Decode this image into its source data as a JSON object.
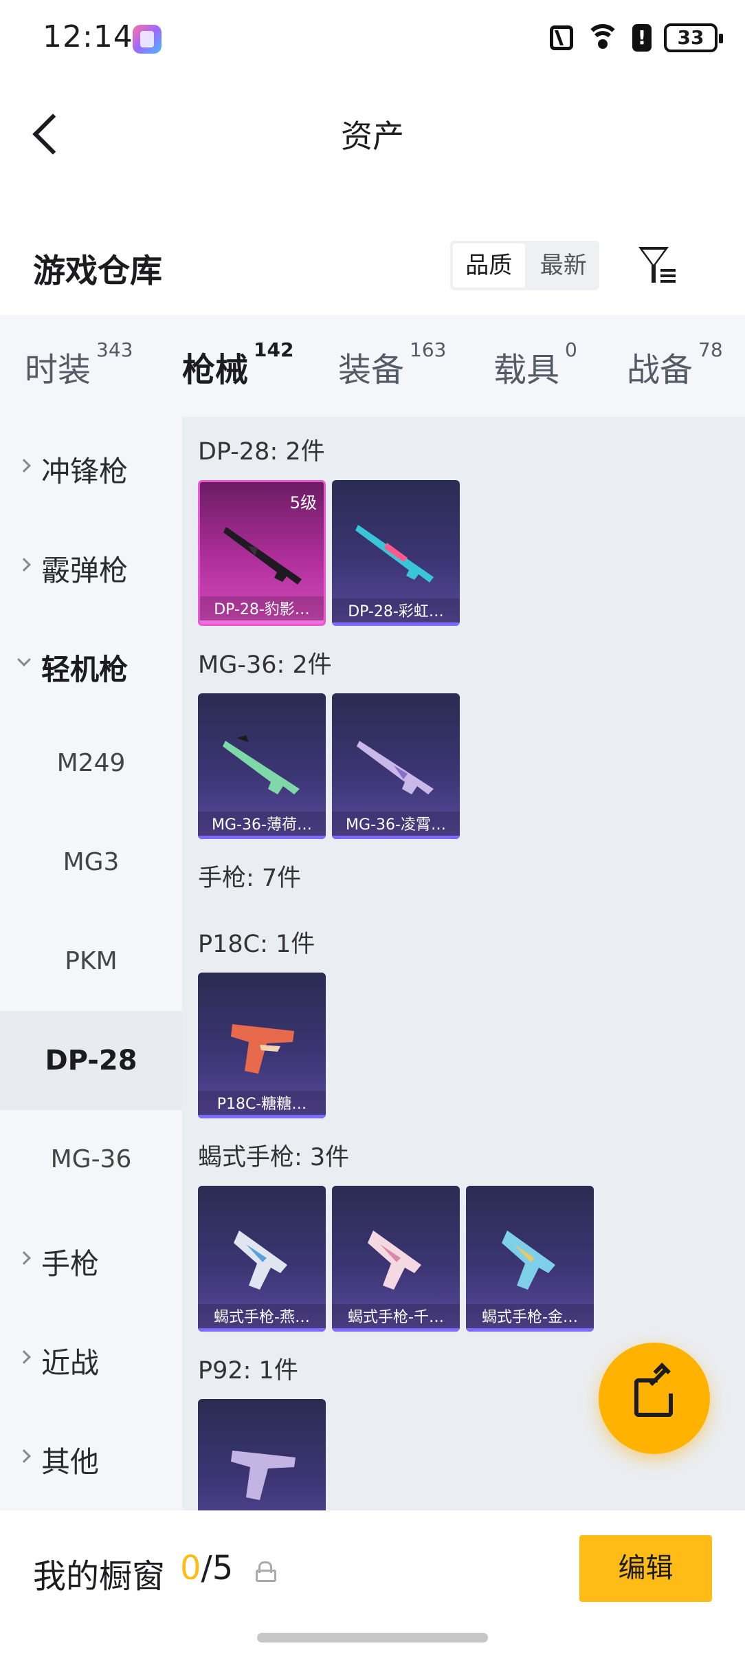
{
  "status_bar": {
    "time": "12:14",
    "battery": "33"
  },
  "header": {
    "title": "资产"
  },
  "section": {
    "title": "游戏仓库"
  },
  "sort": {
    "options": [
      "品质",
      "最新"
    ]
  },
  "tabs": [
    {
      "label": "时装",
      "count": "343"
    },
    {
      "label": "枪械",
      "count": "142"
    },
    {
      "label": "装备",
      "count": "163"
    },
    {
      "label": "载具",
      "count": "0"
    },
    {
      "label": "战备",
      "count": "78"
    }
  ],
  "sidebar": {
    "items": [
      {
        "label": "冲锋枪"
      },
      {
        "label": "霰弹枪"
      },
      {
        "label": "轻机枪"
      },
      {
        "label": "M249"
      },
      {
        "label": "MG3"
      },
      {
        "label": "PKM"
      },
      {
        "label": "DP-28"
      },
      {
        "label": "MG-36"
      },
      {
        "label": "手枪"
      },
      {
        "label": "近战"
      },
      {
        "label": "其他"
      }
    ]
  },
  "groups": [
    {
      "title": "DP-28: 2件",
      "cards": [
        {
          "name": "DP-28-豹影…",
          "level": "5级"
        },
        {
          "name": "DP-28-彩虹…"
        }
      ]
    },
    {
      "title": "MG-36: 2件",
      "cards": [
        {
          "name": "MG-36-薄荷…"
        },
        {
          "name": "MG-36-凌霄…"
        }
      ]
    },
    {
      "title": "手枪: 7件"
    },
    {
      "title": "P18C: 1件",
      "cards": [
        {
          "name": "P18C-糖糖…"
        }
      ]
    },
    {
      "title": "蝎式手枪: 3件",
      "cards": [
        {
          "name": "蝎式手枪-燕…"
        },
        {
          "name": "蝎式手枪-千…"
        },
        {
          "name": "蝎式手枪-金…"
        }
      ]
    },
    {
      "title": "P92: 1件"
    }
  ],
  "bottom": {
    "label": "我的橱窗",
    "count_current": "0",
    "count_total": "/5",
    "edit_label": "编辑"
  },
  "colors": {
    "accent": "#ffbc17",
    "card_purple": "#3b3573",
    "card_pink": "#b02f9b"
  }
}
